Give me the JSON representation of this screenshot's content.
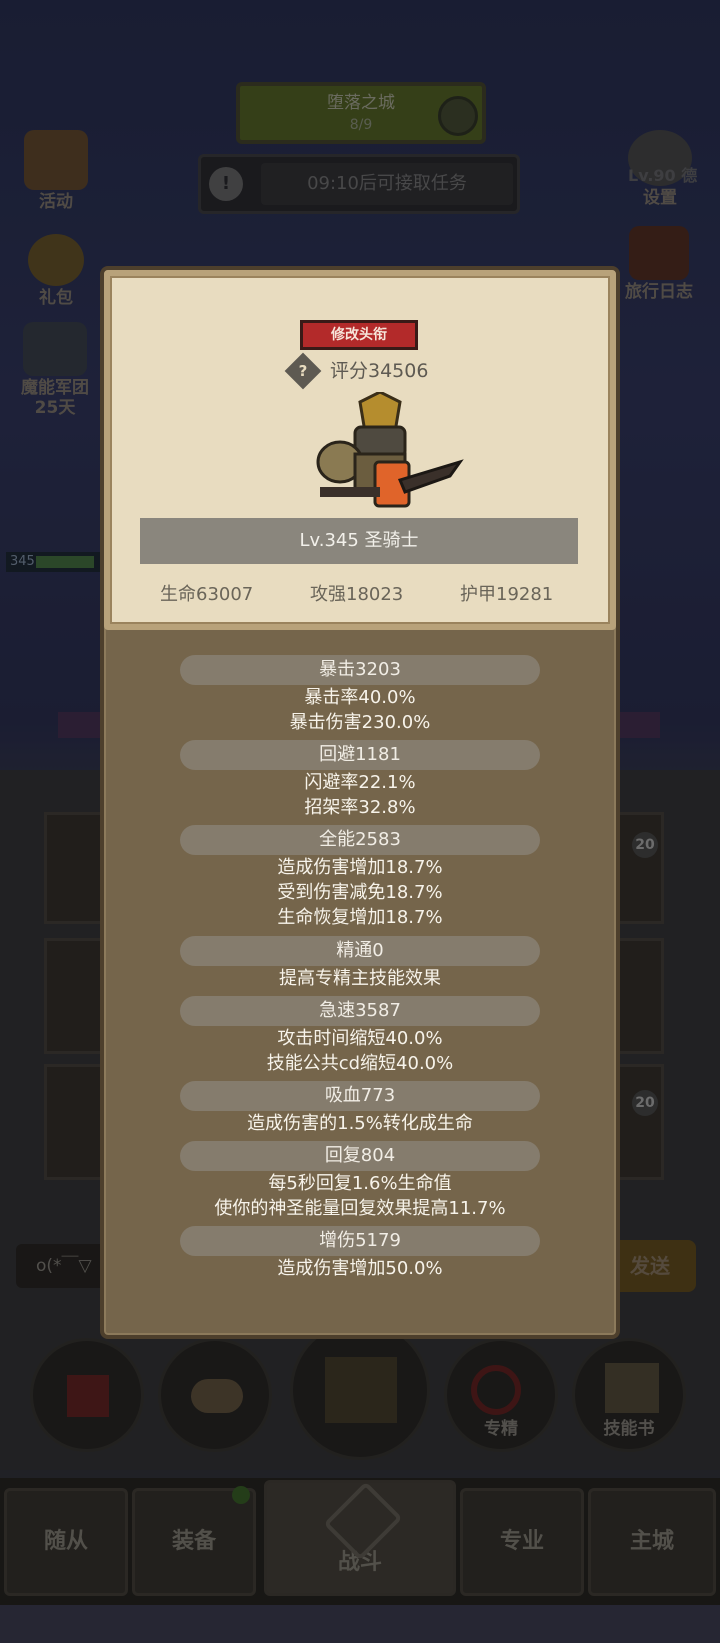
{
  "hud": {
    "zone_name": "堕落之城",
    "zone_progress": "8/9",
    "task_text": "09:10后可接取任务",
    "left_menu": [
      {
        "label": "活动",
        "icon": "scroll-icon"
      },
      {
        "label": "礼包",
        "icon": "gift-coin-icon"
      },
      {
        "label": "魔能军团",
        "sub": "25天",
        "icon": "demon-legion-icon"
      }
    ],
    "right_menu": [
      {
        "label": "设置",
        "icon": "gear-icon"
      },
      {
        "label": "旅行日志",
        "icon": "book-icon"
      }
    ],
    "right_name": "Lv.90 德",
    "player_level": "345",
    "chat_text": "o(*￣▽",
    "send_label": "发送",
    "badge_count": "20"
  },
  "actions": [
    {
      "label": "",
      "icon": "potion-icon"
    },
    {
      "label": "",
      "icon": "bread-icon"
    },
    {
      "label": "",
      "icon": "chest-icon"
    },
    {
      "label": "专精",
      "icon": "specialization-icon"
    },
    {
      "label": "技能书",
      "icon": "skill-book-icon"
    }
  ],
  "tabs": [
    "随从",
    "装备",
    "战斗",
    "专业",
    "主城"
  ],
  "panel": {
    "title_button": "修改头衔",
    "score": "评分34506",
    "level_class": "Lv.345 圣骑士",
    "basic": [
      "生命63007",
      "攻强18023",
      "护甲19281"
    ],
    "stats": [
      {
        "name": "暴击3203",
        "lines": [
          "暴击率40.0%",
          "暴击伤害230.0%"
        ]
      },
      {
        "name": "回避1181",
        "lines": [
          "闪避率22.1%",
          "招架率32.8%"
        ]
      },
      {
        "name": "全能2583",
        "lines": [
          "造成伤害增加18.7%",
          "受到伤害减免18.7%",
          "生命恢复增加18.7%"
        ]
      },
      {
        "name": "精通0",
        "lines": [
          "提高专精主技能效果"
        ]
      },
      {
        "name": "急速3587",
        "lines": [
          "攻击时间缩短40.0%",
          "技能公共cd缩短40.0%"
        ]
      },
      {
        "name": "吸血773",
        "lines": [
          "造成伤害的1.5%转化成生命"
        ]
      },
      {
        "name": "回复804",
        "lines": [
          "每5秒回复1.6%生命值",
          "使你的神圣能量回复效果提高11.7%"
        ]
      },
      {
        "name": "增伤5179",
        "lines": [
          "造成伤害增加50.0%"
        ]
      }
    ]
  },
  "colors": {
    "card_bg": "#e8dcc0",
    "panel_bg": "#75654b",
    "title_red": "#b32a2a"
  }
}
